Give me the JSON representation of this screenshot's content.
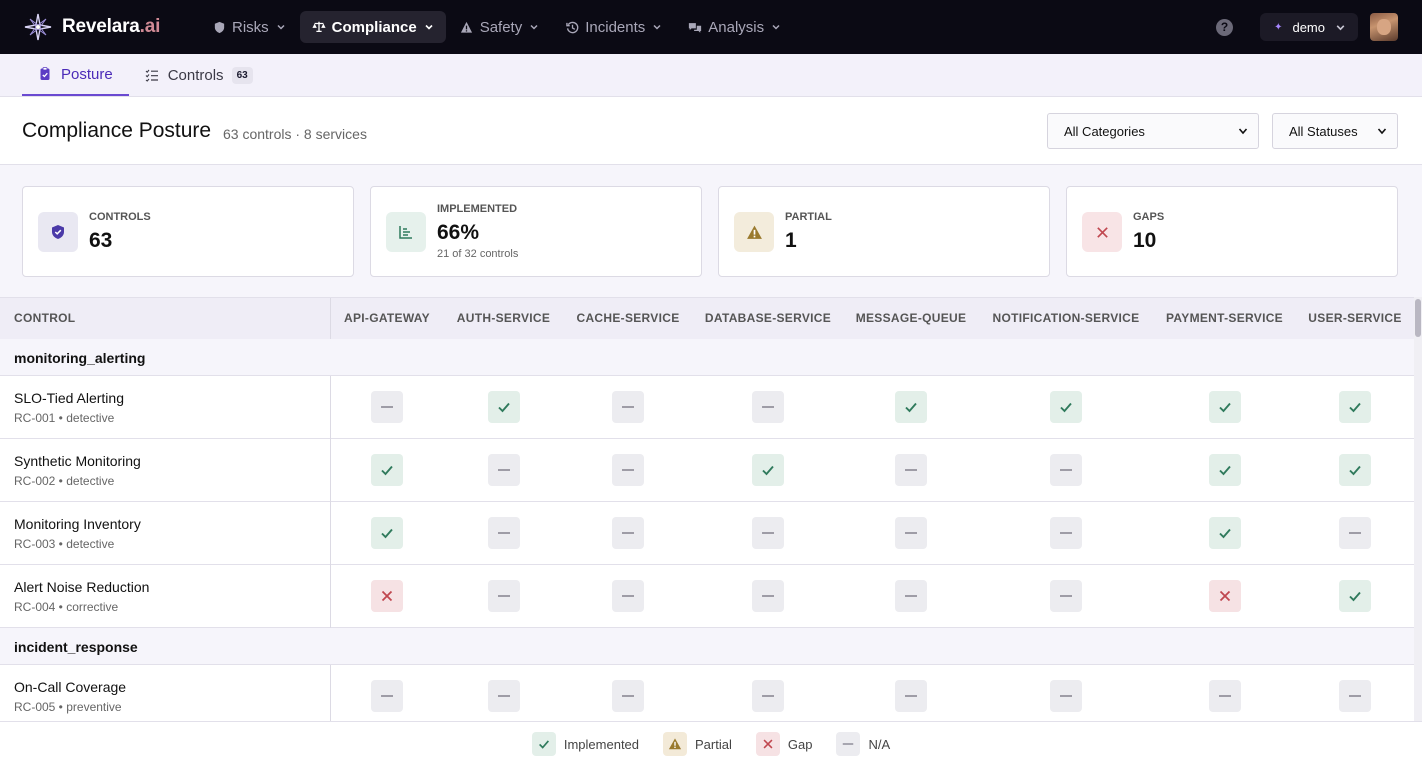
{
  "brand": {
    "name": "Revelara",
    "suffix": ".ai",
    "logo_icon": "compass-star-icon"
  },
  "nav": [
    {
      "label": "Risks",
      "icon": "shield-icon",
      "active": false
    },
    {
      "label": "Compliance",
      "icon": "scales-icon",
      "active": true
    },
    {
      "label": "Safety",
      "icon": "warning-icon",
      "active": false
    },
    {
      "label": "Incidents",
      "icon": "history-icon",
      "active": false
    },
    {
      "label": "Analysis",
      "icon": "chat-bubbles-icon",
      "active": false
    }
  ],
  "user": {
    "help": "?",
    "label": "demo",
    "spark": "✦"
  },
  "subtabs": [
    {
      "label": "Posture",
      "icon": "clipboard-icon",
      "active": true
    },
    {
      "label": "Controls",
      "icon": "list-check-icon",
      "count": "63",
      "active": false
    }
  ],
  "page": {
    "title": "Compliance Posture",
    "subtitle": "63 controls · 8 services"
  },
  "filters": {
    "category": "All Categories",
    "status": "All Statuses"
  },
  "stats": [
    {
      "label": "CONTROLS",
      "value": "63",
      "icon": "shield-check-icon",
      "color": "#4b3aa8"
    },
    {
      "label": "IMPLEMENTED",
      "value": "66%",
      "note": "21 of 32 controls",
      "icon": "bar-chart-icon",
      "color": "#2f7a5c"
    },
    {
      "label": "PARTIAL",
      "value": "1",
      "icon": "warning-icon",
      "color": "#9a7a2e"
    },
    {
      "label": "GAPS",
      "value": "10",
      "icon": "x-icon",
      "color": "#c0474f"
    }
  ],
  "table": {
    "control_header": "CONTROL",
    "services": [
      "API-GATEWAY",
      "AUTH-SERVICE",
      "CACHE-SERVICE",
      "DATABASE-SERVICE",
      "MESSAGE-QUEUE",
      "NOTIFICATION-SERVICE",
      "PAYMENT-SERVICE",
      "USER-SERVICE"
    ],
    "groups": [
      {
        "name": "monitoring_alerting",
        "rows": [
          {
            "name": "SLO-Tied Alerting",
            "meta": "RC-001 • detective",
            "status": [
              "na",
              "impl",
              "na",
              "na",
              "impl",
              "impl",
              "impl",
              "impl"
            ]
          },
          {
            "name": "Synthetic Monitoring",
            "meta": "RC-002 • detective",
            "status": [
              "impl",
              "na",
              "na",
              "impl",
              "na",
              "na",
              "impl",
              "impl"
            ]
          },
          {
            "name": "Monitoring Inventory",
            "meta": "RC-003 • detective",
            "status": [
              "impl",
              "na",
              "na",
              "na",
              "na",
              "na",
              "impl",
              "na"
            ]
          },
          {
            "name": "Alert Noise Reduction",
            "meta": "RC-004 • corrective",
            "status": [
              "gap",
              "na",
              "na",
              "na",
              "na",
              "na",
              "gap",
              "impl"
            ]
          }
        ]
      },
      {
        "name": "incident_response",
        "rows": [
          {
            "name": "On-Call Coverage",
            "meta": "RC-005 • preventive",
            "status": [
              "na",
              "na",
              "na",
              "na",
              "na",
              "na",
              "na",
              "na"
            ]
          }
        ]
      }
    ]
  },
  "legend": [
    {
      "key": "impl",
      "label": "Implemented"
    },
    {
      "key": "partial",
      "label": "Partial"
    },
    {
      "key": "gap",
      "label": "Gap"
    },
    {
      "key": "na",
      "label": "N/A"
    }
  ],
  "status_colors": {
    "impl": "#2f7a5c",
    "gap": "#c0474f",
    "na": "#8a8994",
    "partial": "#9a7a2e"
  }
}
